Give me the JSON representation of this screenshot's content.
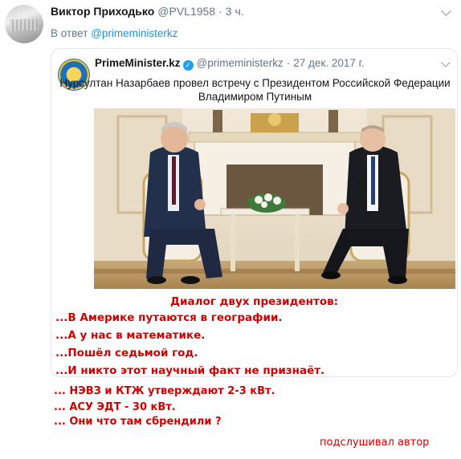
{
  "tweet": {
    "author_name": "Виктор Приходько",
    "handle": "@PVL1958",
    "separator": "·",
    "time": "3 ч.",
    "reply_prefix": "В ответ",
    "reply_mention": "@primeministerkz"
  },
  "quoted_tweet": {
    "author_name": "PrimeMinister.kz",
    "verified_glyph": "✓",
    "handle": "@primeministerkz",
    "separator": "·",
    "date": "27 дек. 2017 г.",
    "text_line1": "Нурсултан Назарбаев провел встречу с Президентом Российской Федерации",
    "text_line2": "Владимиром Путиным",
    "avatar_icon": "kazakhstan-emblem-icon",
    "photo_icon": "meeting-photo"
  },
  "caption": {
    "title": "Диалог двух президентов:",
    "lines": [
      "...В Америке путаются в географии.",
      "...А у нас в математике.",
      "...Пошёл седьмой год.",
      "...И никто этот научный факт не признаёт."
    ]
  },
  "note": {
    "lines": [
      "... НЭВЗ и КТЖ утверждают 2-3 кВт.",
      "... АСУ ЭДТ - 30 кВт.",
      "... Они что там сбрендили ?"
    ],
    "signature": "подслушивал автор"
  },
  "colors": {
    "caption_red": "#d40000",
    "link_blue": "#1b95e0",
    "muted_gray": "#657786",
    "border": "#e1e8ed"
  }
}
